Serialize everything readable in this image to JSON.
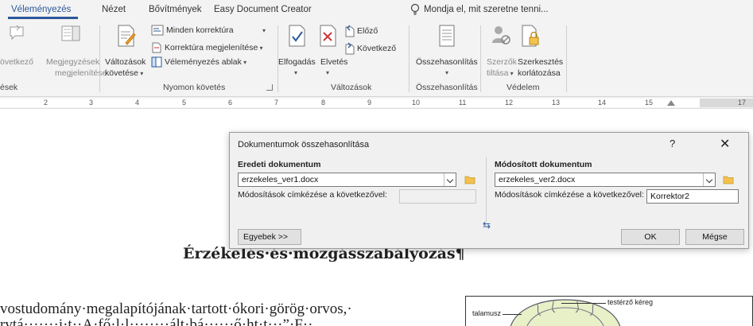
{
  "tabs": [
    {
      "label": "Véleményezés",
      "active": true
    },
    {
      "label": "Nézet"
    },
    {
      "label": "Bővítmények"
    },
    {
      "label": "Easy Document Creator"
    }
  ],
  "tell_me": "Mondja el, mit szeretne tenni...",
  "ribbon": {
    "group_comments_tail": {
      "label": "ések",
      "next_label": "övetkező",
      "show_comments": [
        "Megjegyzések",
        "megjelenítése"
      ]
    },
    "tracking": {
      "track_changes": [
        "Változások",
        "követése"
      ],
      "markup_select": "Minden korrektúra",
      "show_markup": "Korrektúra megjelenítése",
      "review_pane": "Véleményezés ablak",
      "label": "Nyomon követés"
    },
    "changes": {
      "accept": "Elfogadás",
      "reject": "Elvetés",
      "previous": "Előző",
      "next": "Következő",
      "label": "Változások"
    },
    "compare": {
      "button": "Összehasonlítás",
      "label": "Összehasonlítás"
    },
    "protect": {
      "block_authors": [
        "Szerzők",
        "tiltása"
      ],
      "restrict_editing": [
        "Szerkesztés",
        "korlátozása"
      ],
      "label": "Védelem"
    }
  },
  "ruler": {
    "numbers": [
      "2",
      "3",
      "4",
      "5",
      "6",
      "7",
      "8",
      "9",
      "10",
      "11",
      "12",
      "13",
      "14",
      "15",
      "17"
    ]
  },
  "dialog": {
    "title": "Dokumentumok összehasonlítása",
    "help": "?",
    "close": "✕",
    "original_label": "Eredeti dokumentum",
    "original_value": "erzekeles_ver1.docx",
    "original_label_changes": "Módosítások címkézése a következővel:",
    "original_label_changes_value": "",
    "revised_label": "Módosított dokumentum",
    "revised_value": "erzekeles_ver2.docx",
    "revised_label_changes": "Módosítások címkézése a következővel:",
    "revised_label_changes_value": "Korrektor2",
    "more_button": "Egyebek >>",
    "ok_button": "OK",
    "cancel_button": "Mégse"
  },
  "document": {
    "title": "Érzékelés·és·mozgásszabályozás¶",
    "line1": "vostudomány·megalapítójának·tartott·ókori·görög·orvos,·",
    "line2": "rvtá·······i·t··A·fő·l·l········ált·bá······ő·ht·t···”·F··",
    "figure_labels": {
      "top": "testérző kéreg",
      "left": "talamusz"
    }
  },
  "colors": {
    "accent": "#2b579a",
    "ribbon_bg": "#f3f3f3",
    "dialog_bg": "#f0f0f0"
  }
}
